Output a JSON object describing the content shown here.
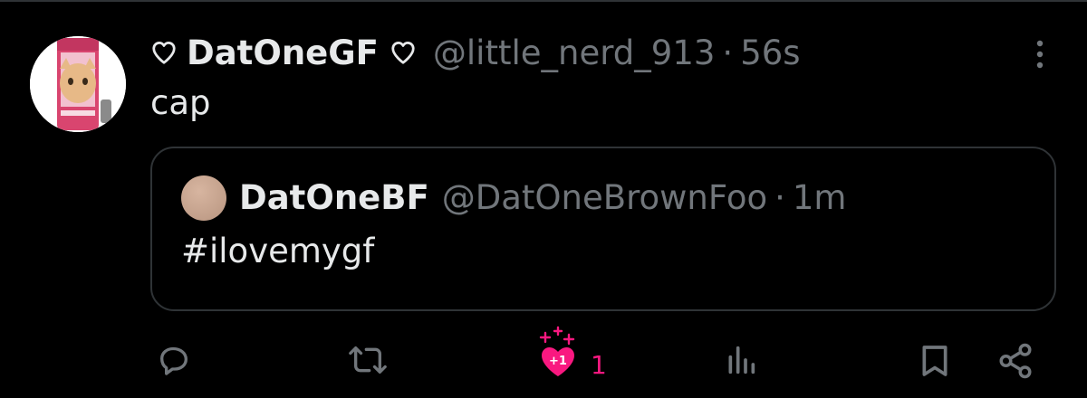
{
  "tweet": {
    "display_name": "DatOneGF",
    "handle": "@little_nerd_913",
    "separator": "·",
    "time": "56s",
    "text": "cap",
    "avatar_icon": "pink-energy-drink-cat-avatar"
  },
  "quoted_tweet": {
    "display_name": "DatOneBF",
    "handle": "@DatOneBrownFoo",
    "separator": "·",
    "time": "1m",
    "text": "#ilovemygf",
    "avatar_color": "#c9a48f"
  },
  "actions": {
    "reply_icon": "reply-icon",
    "retweet_icon": "retweet-icon",
    "like_icon": "heart-plus-one-icon",
    "like_badge": "+1",
    "like_count": "1",
    "views_icon": "views-icon",
    "bookmark_icon": "bookmark-icon",
    "share_icon": "share-icon"
  },
  "colors": {
    "background": "#000000",
    "text_primary": "#e7e9ea",
    "text_secondary": "#71767b",
    "border": "#2f3336",
    "like_accent": "#f91880"
  }
}
